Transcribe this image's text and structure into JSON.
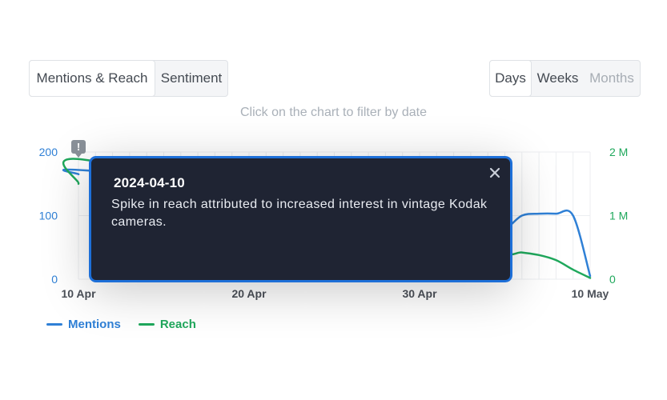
{
  "metric_tabs": {
    "mentions_reach": "Mentions & Reach",
    "sentiment": "Sentiment",
    "active": "mentions_reach"
  },
  "range_tabs": {
    "days": "Days",
    "weeks": "Weeks",
    "months": "Months",
    "active": "days",
    "disabled": "months"
  },
  "hint": "Click on the chart to filter by date",
  "tooltip": {
    "date": "2024-04-10",
    "text": "Spike in reach attributed to increased interest in vintage Kodak cameras.",
    "marker_icon": "exclamation-icon",
    "close_icon": "close-icon"
  },
  "colors": {
    "mentions": "#2f80d6",
    "reach": "#1fa85c",
    "grid": "#eceef1",
    "marker": "#8a9199"
  },
  "chart_data": {
    "type": "line",
    "x_labels": [
      "10 Apr",
      "20 Apr",
      "30 Apr",
      "10 May"
    ],
    "x_range": [
      "2024-04-10",
      "2024-05-10"
    ],
    "left_axis": {
      "ticks": [
        "0",
        "100",
        "200"
      ],
      "ylim": [
        0,
        200
      ]
    },
    "right_axis": {
      "ticks": [
        "0",
        "1 M",
        "2 M"
      ],
      "ylim": [
        0,
        2000000
      ]
    },
    "grid": true,
    "legend_position": "bottom-left",
    "series": [
      {
        "name": "Mentions",
        "axis": "left",
        "x": [
          "2024-04-10",
          "2024-04-11",
          "2024-05-02",
          "2024-05-03",
          "2024-05-04",
          "2024-05-05",
          "2024-05-06",
          "2024-05-07",
          "2024-05-08",
          "2024-05-09",
          "2024-05-10"
        ],
        "y": [
          165,
          170,
          122,
          118,
          90,
          80,
          100,
          103,
          103,
          100,
          5
        ]
      },
      {
        "name": "Reach",
        "axis": "right",
        "x": [
          "2024-04-10",
          "2024-04-11",
          "2024-05-02",
          "2024-05-03",
          "2024-05-04",
          "2024-05-05",
          "2024-05-06",
          "2024-05-07",
          "2024-05-08",
          "2024-05-09",
          "2024-05-10"
        ],
        "y": [
          1500000,
          1850000,
          380000,
          300000,
          1150000,
          450000,
          420000,
          380000,
          300000,
          150000,
          20000
        ]
      }
    ],
    "markers": [
      {
        "x": "2024-04-10"
      }
    ]
  },
  "legend": [
    {
      "label": "Mentions",
      "color": "#2f80d6"
    },
    {
      "label": "Reach",
      "color": "#1fa85c"
    }
  ]
}
